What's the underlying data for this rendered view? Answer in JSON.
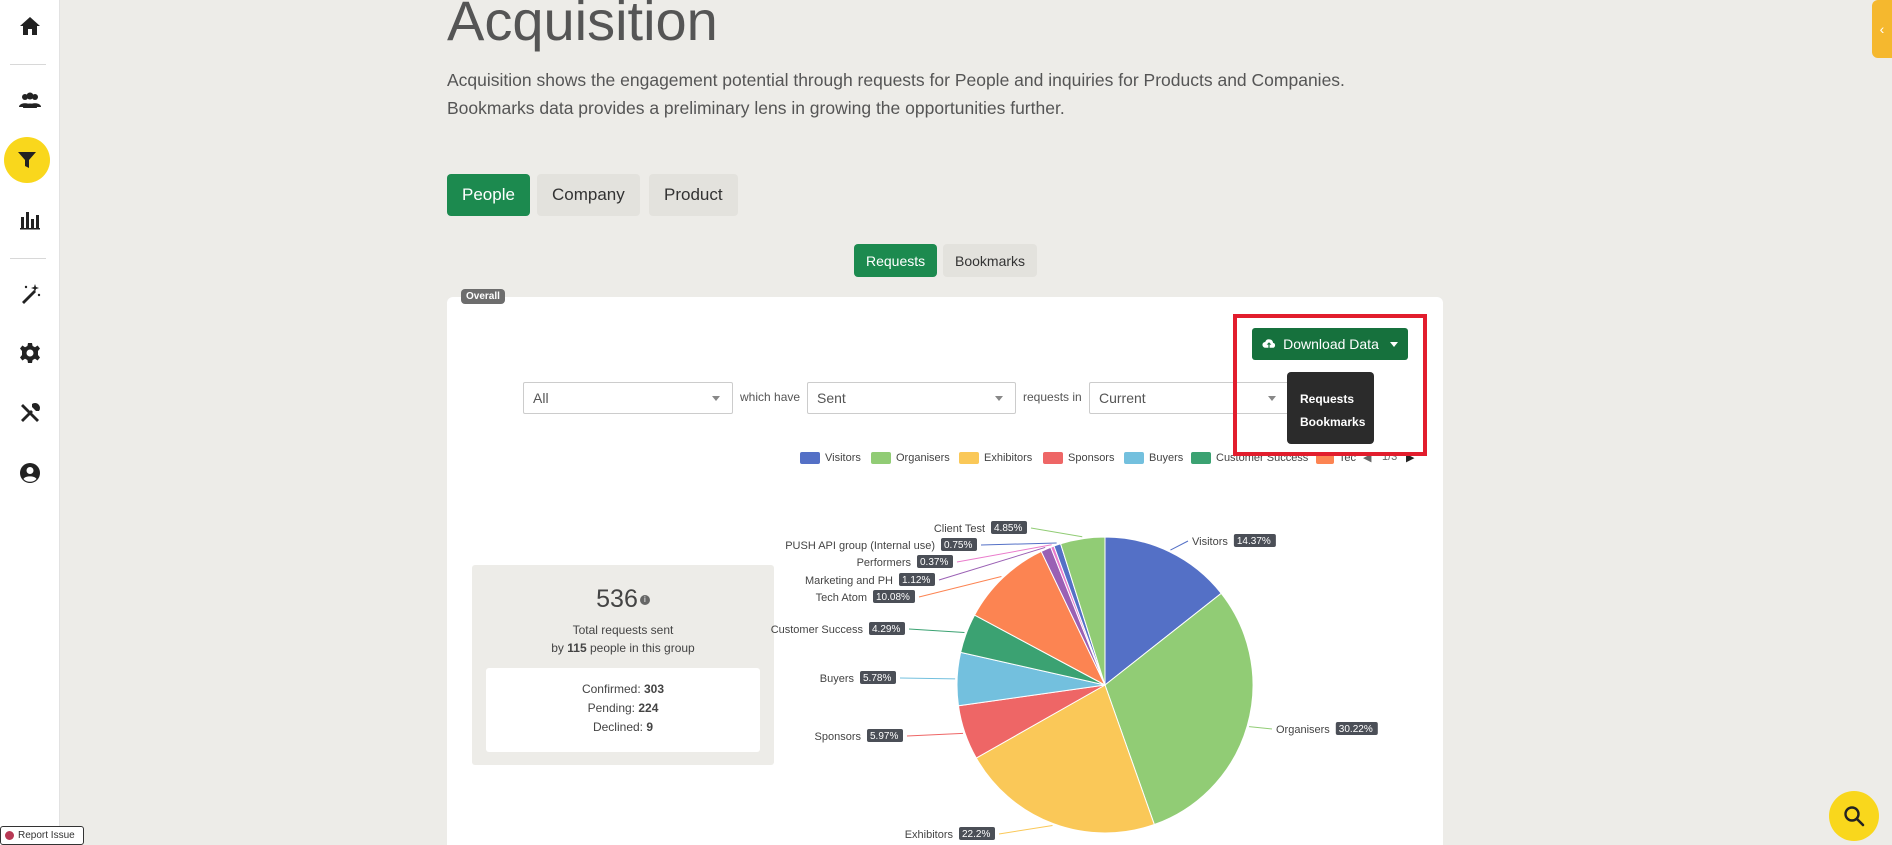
{
  "sidebar": {
    "items": [
      {
        "name": "home-icon"
      },
      {
        "name": "users-icon"
      },
      {
        "name": "filter-icon",
        "active": true
      },
      {
        "name": "bar-chart-icon"
      },
      {
        "name": "magic-wand-icon"
      },
      {
        "name": "gear-icon"
      },
      {
        "name": "tools-icon"
      },
      {
        "name": "user-circle-icon"
      }
    ]
  },
  "header": {
    "title": "Acquisition",
    "description_line1": "Acquisition shows the engagement potential through requests for People and inquiries for Products and Companies.",
    "description_line2": "Bookmarks data provides a preliminary lens in growing the opportunities further."
  },
  "tabs": {
    "people": "People",
    "company": "Company",
    "product": "Product",
    "active": "People"
  },
  "subtabs": {
    "requests": "Requests",
    "bookmarks": "Bookmarks",
    "active": "Requests"
  },
  "card": {
    "badge": "Overall"
  },
  "download": {
    "label": "Download Data",
    "menu": [
      "Requests",
      "Bookmarks"
    ]
  },
  "filters": {
    "group": "All",
    "which_have": "which have",
    "status": "Sent",
    "requests_in": "requests in",
    "period": "Current"
  },
  "legend": {
    "items": [
      {
        "label": "Visitors",
        "color": "#5470c6"
      },
      {
        "label": "Organisers",
        "color": "#91cc75"
      },
      {
        "label": "Exhibitors",
        "color": "#fac858"
      },
      {
        "label": "Sponsors",
        "color": "#ee6666"
      },
      {
        "label": "Buyers",
        "color": "#73c0de"
      },
      {
        "label": "Customer Success",
        "color": "#3ba272"
      },
      {
        "label": "Tec",
        "color": "#fc8452"
      }
    ],
    "page": "1/3"
  },
  "stats": {
    "total": "536",
    "caption_prefix": "Total requests sent",
    "caption_by": "by",
    "caption_count": "115",
    "caption_suffix": "people in this group",
    "confirmed_label": "Confirmed:",
    "confirmed": "303",
    "pending_label": "Pending:",
    "pending": "224",
    "declined_label": "Declined:",
    "declined": "9"
  },
  "chart_data": {
    "type": "pie",
    "series": [
      {
        "name": "Visitors",
        "value": 14.37,
        "label": "14.37%",
        "color": "#5470c6"
      },
      {
        "name": "Organisers",
        "value": 30.22,
        "label": "30.22%",
        "color": "#91cc75"
      },
      {
        "name": "Exhibitors",
        "value": 22.2,
        "label": "22.2%",
        "color": "#fac858"
      },
      {
        "name": "Sponsors",
        "value": 5.97,
        "label": "5.97%",
        "color": "#ee6666"
      },
      {
        "name": "Buyers",
        "value": 5.78,
        "label": "5.78%",
        "color": "#73c0de"
      },
      {
        "name": "Customer Success",
        "value": 4.29,
        "label": "4.29%",
        "color": "#3ba272"
      },
      {
        "name": "Tech Atom",
        "value": 10.08,
        "label": "10.08%",
        "color": "#fc8452"
      },
      {
        "name": "Marketing and PH",
        "value": 1.12,
        "label": "1.12%",
        "color": "#9a60b4"
      },
      {
        "name": "Performers",
        "value": 0.37,
        "label": "0.37%",
        "color": "#ea7ccc"
      },
      {
        "name": "PUSH API group (Internal use)",
        "value": 0.75,
        "label": "0.75%",
        "color": "#5470c6"
      },
      {
        "name": "Client Test",
        "value": 4.85,
        "label": "4.85%",
        "color": "#91cc75"
      }
    ]
  },
  "footer": {
    "report_issue": "Report Issue"
  }
}
